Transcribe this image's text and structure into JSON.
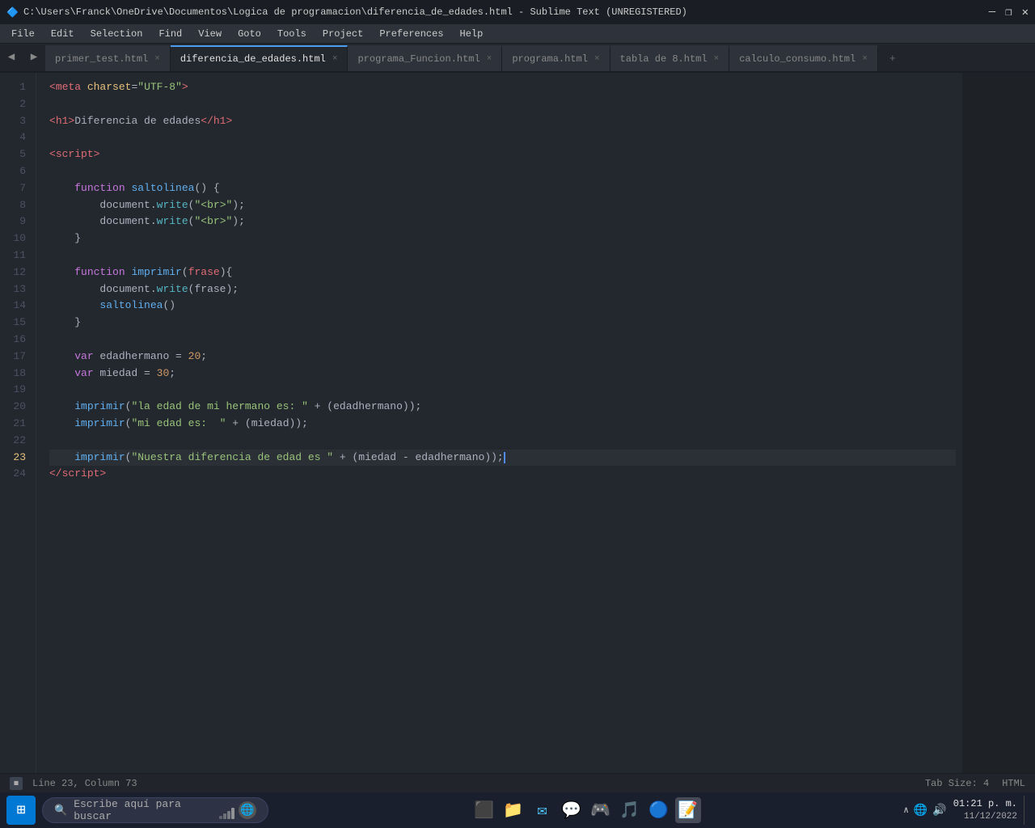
{
  "titlebar": {
    "title": "C:\\Users\\Franck\\OneDrive\\Documentos\\Logica de programacion\\diferencia_de_edades.html - Sublime Text (UNREGISTERED)",
    "minimize": "—",
    "maximize": "❐",
    "close": "✕"
  },
  "menubar": {
    "items": [
      "File",
      "Edit",
      "Selection",
      "Find",
      "View",
      "Goto",
      "Tools",
      "Project",
      "Preferences",
      "Help"
    ]
  },
  "tabs": [
    {
      "label": "primer_test.html",
      "active": false,
      "closable": true
    },
    {
      "label": "diferencia_de_edades.html",
      "active": true,
      "closable": true
    },
    {
      "label": "programa_Funcion.html",
      "active": false,
      "closable": true
    },
    {
      "label": "programa.html",
      "active": false,
      "closable": true
    },
    {
      "label": "tabla de 8.html",
      "active": false,
      "closable": true
    },
    {
      "label": "calculo_consumo.html",
      "active": false,
      "closable": true
    }
  ],
  "editor": {
    "current_line": 23,
    "current_column": 73
  },
  "statusbar": {
    "position": "Line 23, Column 73",
    "tab_size": "Tab Size: 4",
    "syntax": "HTML"
  },
  "taskbar": {
    "search_placeholder": "Escribe aquí para buscar",
    "clock_time": "01:21 p. m.",
    "clock_date": "11/12/2022"
  },
  "lines": [
    {
      "num": 1,
      "content": [
        {
          "t": "<",
          "c": "tag"
        },
        {
          "t": "meta",
          "c": "tag"
        },
        {
          "t": " charset",
          "c": "attr"
        },
        {
          "t": "=",
          "c": "punct"
        },
        {
          "t": "\"UTF-8\"",
          "c": "str"
        },
        {
          "t": ">",
          "c": "tag"
        }
      ]
    },
    {
      "num": 2,
      "content": []
    },
    {
      "num": 3,
      "content": [
        {
          "t": "<",
          "c": "tag"
        },
        {
          "t": "h1",
          "c": "tag"
        },
        {
          "t": ">",
          "c": "tag"
        },
        {
          "t": "Diferencia de edades",
          "c": "plain"
        },
        {
          "t": "</",
          "c": "tag"
        },
        {
          "t": "h1",
          "c": "tag"
        },
        {
          "t": ">",
          "c": "tag"
        }
      ]
    },
    {
      "num": 4,
      "content": []
    },
    {
      "num": 5,
      "content": [
        {
          "t": "<",
          "c": "tag"
        },
        {
          "t": "script",
          "c": "tag"
        },
        {
          "t": ">",
          "c": "tag"
        }
      ]
    },
    {
      "num": 6,
      "content": []
    },
    {
      "num": 7,
      "content": [
        {
          "t": "    ",
          "c": "plain"
        },
        {
          "t": "function",
          "c": "kw"
        },
        {
          "t": " ",
          "c": "plain"
        },
        {
          "t": "saltolinea",
          "c": "fn"
        },
        {
          "t": "() {",
          "c": "plain"
        }
      ]
    },
    {
      "num": 8,
      "content": [
        {
          "t": "        ",
          "c": "plain"
        },
        {
          "t": "document",
          "c": "plain"
        },
        {
          "t": ".",
          "c": "punct"
        },
        {
          "t": "write",
          "c": "method"
        },
        {
          "t": "(",
          "c": "plain"
        },
        {
          "t": "\"<br>\"",
          "c": "str"
        },
        {
          "t": ");",
          "c": "plain"
        }
      ]
    },
    {
      "num": 9,
      "content": [
        {
          "t": "        ",
          "c": "plain"
        },
        {
          "t": "document",
          "c": "plain"
        },
        {
          "t": ".",
          "c": "punct"
        },
        {
          "t": "write",
          "c": "method"
        },
        {
          "t": "(",
          "c": "plain"
        },
        {
          "t": "\"<br>\"",
          "c": "str"
        },
        {
          "t": ");",
          "c": "plain"
        }
      ]
    },
    {
      "num": 10,
      "content": [
        {
          "t": "    }",
          "c": "plain"
        }
      ]
    },
    {
      "num": 11,
      "content": []
    },
    {
      "num": 12,
      "content": [
        {
          "t": "    ",
          "c": "plain"
        },
        {
          "t": "function",
          "c": "kw"
        },
        {
          "t": " ",
          "c": "plain"
        },
        {
          "t": "imprimir",
          "c": "fn"
        },
        {
          "t": "(",
          "c": "plain"
        },
        {
          "t": "frase",
          "c": "param"
        },
        {
          "t": "){",
          "c": "plain"
        }
      ]
    },
    {
      "num": 13,
      "content": [
        {
          "t": "        ",
          "c": "plain"
        },
        {
          "t": "document",
          "c": "plain"
        },
        {
          "t": ".",
          "c": "punct"
        },
        {
          "t": "write",
          "c": "method"
        },
        {
          "t": "(frase);",
          "c": "plain"
        }
      ]
    },
    {
      "num": 14,
      "content": [
        {
          "t": "        ",
          "c": "plain"
        },
        {
          "t": "saltolinea",
          "c": "fn"
        },
        {
          "t": "()",
          "c": "plain"
        }
      ]
    },
    {
      "num": 15,
      "content": [
        {
          "t": "    }",
          "c": "plain"
        }
      ]
    },
    {
      "num": 16,
      "content": []
    },
    {
      "num": 17,
      "content": [
        {
          "t": "    ",
          "c": "plain"
        },
        {
          "t": "var",
          "c": "kw"
        },
        {
          "t": " edadhermano = ",
          "c": "plain"
        },
        {
          "t": "20",
          "c": "num"
        },
        {
          "t": ";",
          "c": "plain"
        }
      ]
    },
    {
      "num": 18,
      "content": [
        {
          "t": "    ",
          "c": "plain"
        },
        {
          "t": "var",
          "c": "kw"
        },
        {
          "t": " miedad = ",
          "c": "plain"
        },
        {
          "t": "30",
          "c": "num"
        },
        {
          "t": ";",
          "c": "plain"
        }
      ]
    },
    {
      "num": 19,
      "content": []
    },
    {
      "num": 20,
      "content": [
        {
          "t": "    ",
          "c": "plain"
        },
        {
          "t": "imprimir",
          "c": "fn"
        },
        {
          "t": "(",
          "c": "plain"
        },
        {
          "t": "\"la edad de mi hermano es: \"",
          "c": "str"
        },
        {
          "t": " + (edadhermano));",
          "c": "plain"
        }
      ]
    },
    {
      "num": 21,
      "content": [
        {
          "t": "    ",
          "c": "plain"
        },
        {
          "t": "imprimir",
          "c": "fn"
        },
        {
          "t": "(",
          "c": "plain"
        },
        {
          "t": "\"mi edad es:  \"",
          "c": "str"
        },
        {
          "t": " + (miedad));",
          "c": "plain"
        }
      ]
    },
    {
      "num": 22,
      "content": []
    },
    {
      "num": 23,
      "content": [
        {
          "t": "    ",
          "c": "plain"
        },
        {
          "t": "imprimir",
          "c": "fn"
        },
        {
          "t": "(",
          "c": "plain"
        },
        {
          "t": "\"Nuestra diferencia de edad es \"",
          "c": "str"
        },
        {
          "t": " + (miedad - edadhermano));",
          "c": "plain"
        },
        {
          "t": "CURSOR",
          "c": "cursor"
        }
      ]
    },
    {
      "num": 24,
      "content": [
        {
          "t": "</",
          "c": "tag"
        },
        {
          "t": "script",
          "c": "tag"
        },
        {
          "t": ">",
          "c": "tag"
        }
      ]
    }
  ]
}
